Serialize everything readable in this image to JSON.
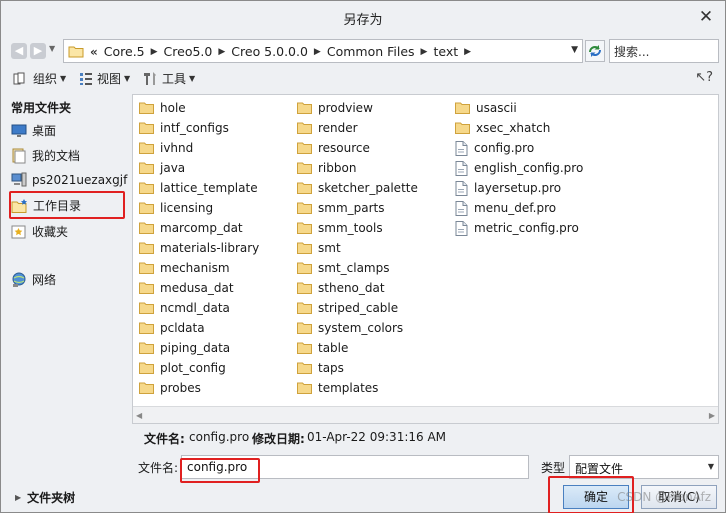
{
  "window": {
    "title": "另存为"
  },
  "address": {
    "breadcrumbs": [
      "Core.5",
      "Creo5.0",
      "Creo 5.0.0.0",
      "Common Files",
      "text"
    ],
    "search_placeholder": "搜索..."
  },
  "toolbar": {
    "organize": "组织",
    "view": "视图",
    "tools": "工具"
  },
  "sidebar": {
    "heading": "常用文件夹",
    "items": [
      {
        "label": "桌面",
        "icon": "desktop-icon"
      },
      {
        "label": "我的文档",
        "icon": "documents-icon"
      },
      {
        "label": "ps2021uezaxgjf",
        "icon": "computer-icon"
      },
      {
        "label": "工作目录",
        "icon": "working-directory-icon"
      },
      {
        "label": "收藏夹",
        "icon": "favorites-icon"
      },
      {
        "label": "网络",
        "icon": "network-icon"
      }
    ]
  },
  "files": {
    "col1": [
      "hole",
      "intf_configs",
      "ivhnd",
      "java",
      "lattice_template",
      "licensing",
      "marcomp_dat",
      "materials-library",
      "mechanism",
      "medusa_dat",
      "ncmdl_data",
      "pcldata",
      "piping_data",
      "plot_config",
      "probes"
    ],
    "col2": [
      "prodview",
      "render",
      "resource",
      "ribbon",
      "sketcher_palette",
      "smm_parts",
      "smm_tools",
      "smt",
      "smt_clamps",
      "stheno_dat",
      "striped_cable",
      "system_colors",
      "table",
      "taps",
      "templates"
    ],
    "col3_folders": [
      "usascii",
      "xsec_xhatch"
    ],
    "col3_files": [
      "config.pro",
      "english_config.pro",
      "layersetup.pro",
      "menu_def.pro",
      "metric_config.pro"
    ]
  },
  "info": {
    "filename_label": "文件名:",
    "filename_value": "config.pro",
    "modified_label": "修改日期:",
    "modified_value": "01-Apr-22 09:31:16 AM"
  },
  "form": {
    "name_label": "文件名:",
    "name_value": "config.pro",
    "type_label": "类型",
    "type_value": "配置文件"
  },
  "footer": {
    "tree_label": "文件夹树",
    "ok_label": "确定",
    "cancel_label": "取消(C)",
    "watermark": "CSDN @PlanAfz"
  },
  "colors": {
    "highlight": "#e02020",
    "folder": "#e8c15a",
    "primary": "#bcd6f0"
  }
}
